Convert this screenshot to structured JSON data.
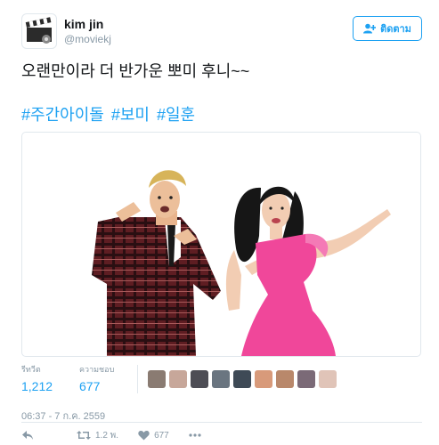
{
  "user": {
    "name": "kim jin",
    "handle": "@moviekj"
  },
  "follow_button": {
    "label": "ติดตาม",
    "icon": "add-user-icon"
  },
  "tweet": {
    "text": "오랜만이라 더 반가운 뽀미 후니~~",
    "hashtags": [
      "#주간아이돌",
      "#보미",
      "#일훈"
    ]
  },
  "stats": {
    "retweets_label": "รีทวีต",
    "retweets_value": "1,212",
    "likes_label": "ความชอบ",
    "likes_value": "677",
    "liker_avatars": [
      "#8a7b72",
      "#c7a79a",
      "#4d4d55",
      "#6a7580",
      "#3e4a56",
      "#d89a7a",
      "#b9886b",
      "#7b6a77",
      "#e0c4b8"
    ]
  },
  "timestamp": "06:37 - 7 ก.ค. 2559",
  "actions": {
    "reply_icon": "reply-icon",
    "retweet_count": "1.2 พ.",
    "like_count": "677",
    "more_icon": "more-icon"
  },
  "colors": {
    "accent": "#1da1f2",
    "muted": "#8899a6",
    "pink": "#f0479a"
  }
}
